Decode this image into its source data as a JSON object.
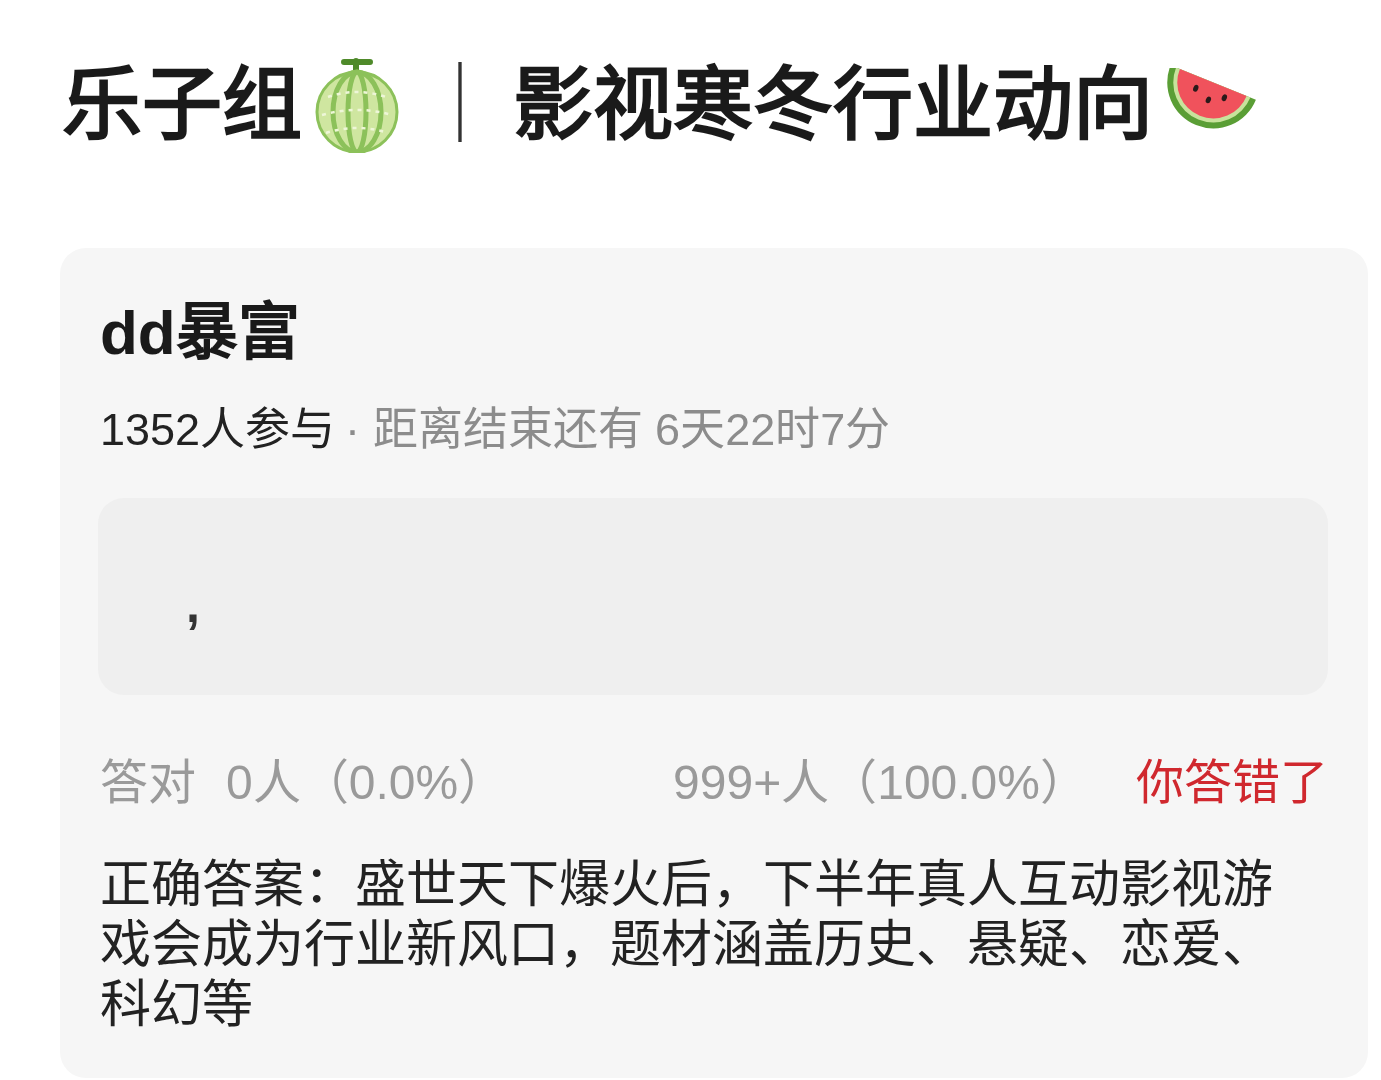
{
  "header": {
    "group": "乐子组",
    "separator": "｜",
    "topic": "影视寒冬行业动向"
  },
  "quiz": {
    "title": "dd暴富",
    "participants": "1352人参与",
    "countdown": "· 距离结束还有 6天22时7分",
    "answer": ",",
    "result": {
      "correct_label": "答对",
      "correct_count": "0人（0.0%）",
      "wrong_count": "999+人（100.0%）",
      "verdict": "你答错了",
      "user_correct": false
    },
    "correct_answer": "正确答案：盛世天下爆火后，下半年真人互动影视游戏会成为行业新风口，题材涵盖历史、悬疑、恋爱、科幻等"
  }
}
